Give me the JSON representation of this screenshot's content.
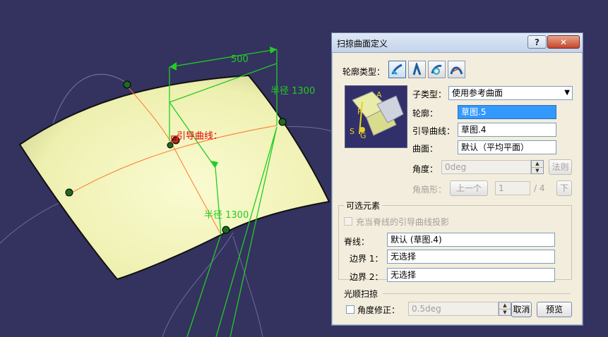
{
  "viewport": {
    "labels": {
      "dim_500": "500",
      "radius_top": "半径 1300",
      "radius_bottom": "半径 1300",
      "guide_curve_tag": "引导曲线："
    },
    "colors": {
      "background": "#34325f",
      "surface": "#f0f2b0",
      "dimension": "#22cc22",
      "guide": "#ff7a2a"
    }
  },
  "dialog": {
    "title": "扫掠曲面定义",
    "help_label": "?",
    "close_label": "✕",
    "profile_type_label": "轮廓类型：",
    "profile_types": [
      {
        "name": "explicit-profile-icon"
      },
      {
        "name": "line-profile-icon"
      },
      {
        "name": "circle-profile-icon"
      },
      {
        "name": "conic-profile-icon"
      }
    ],
    "subtype_label": "子类型：",
    "subtype_value": "使用参考曲面",
    "profile_label": "轮廓：",
    "profile_value": "草图.5",
    "guide_label": "引导曲线：",
    "guide_value": "草图.4",
    "surface_label": "曲面：",
    "surface_value": "默认（平均平面）",
    "preview_letters": {
      "a": "A",
      "p": "P",
      "s": "S",
      "g": "G"
    },
    "angle_label": "角度：",
    "angle_value": "0deg",
    "law_button": "法则",
    "sector_label": "角扇形：",
    "prev_button": "上一个",
    "sector_value": "1",
    "sector_total": "/ 4",
    "next_button": "下",
    "optional_group_title": "可选元素",
    "projection_label": "充当脊线的引导曲线投影",
    "spine_label": "脊线：",
    "spine_value": "默认 (草图.4)",
    "boundary1_label": "边界 1：",
    "boundary1_value": "无选择",
    "boundary2_label": "边界 2：",
    "boundary2_value": "无选择",
    "smooth_section": "光顺扫掠",
    "angle_correction_label": "角度修正：",
    "angle_correction_value": "0.5deg",
    "cancel_button": "取消",
    "preview_button": "预览"
  }
}
